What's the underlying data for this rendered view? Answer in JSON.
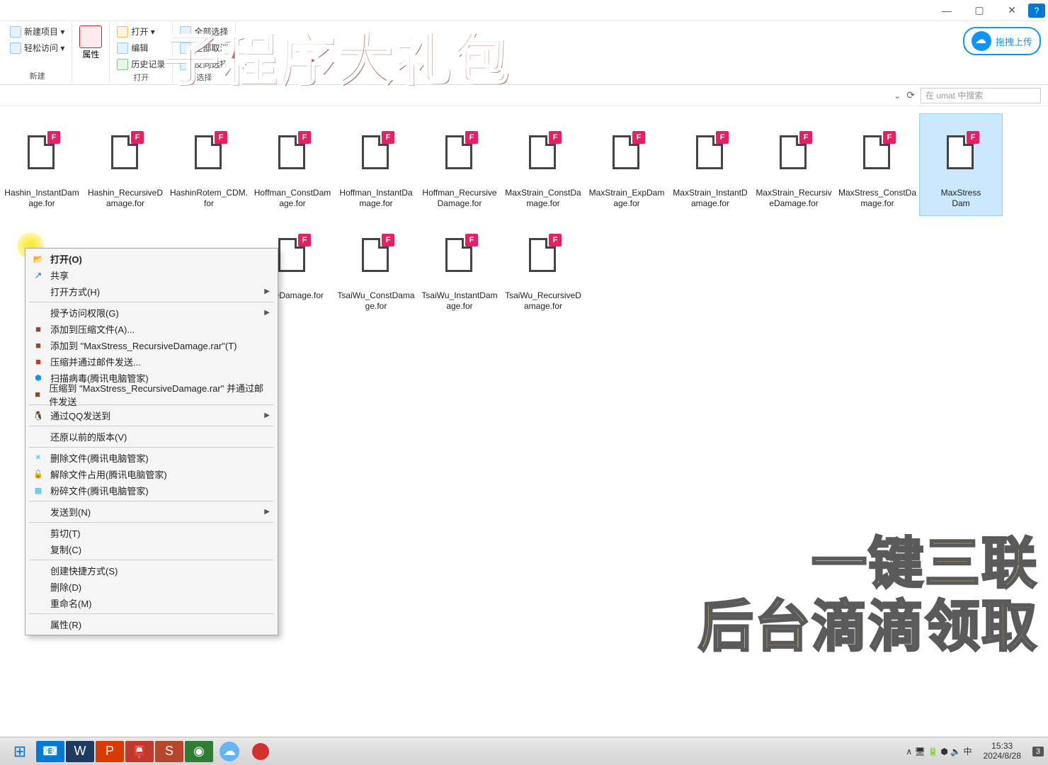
{
  "window": {
    "help": "?"
  },
  "ribbon": {
    "new_project": "新建项目 ▾",
    "quick_access": "轻松访问 ▾",
    "new_label": "新建",
    "properties": "属性",
    "open": "打开 ▾",
    "edit": "编辑",
    "history": "历史记录",
    "open_label": "打开",
    "select_all": "全部选择",
    "select_none": "全部取消",
    "invert": "反向选择",
    "select_label": "选择",
    "upload": "拖拽上传"
  },
  "addressbar": {
    "chevron": "⌄",
    "refresh": "⟳"
  },
  "search": {
    "placeholder": "在 umat 中搜索"
  },
  "files": [
    {
      "name": "Hashin_InstantDamage.for"
    },
    {
      "name": "Hashin_RecursiveDamage.for"
    },
    {
      "name": "HashinRotem_CDM.for"
    },
    {
      "name": "Hoffman_ConstDamage.for"
    },
    {
      "name": "Hoffman_InstantDamage.for"
    },
    {
      "name": "Hoffman_RecursiveDamage.for"
    },
    {
      "name": "MaxStrain_ConstDamage.for"
    },
    {
      "name": "MaxStrain_ExpDamage.for"
    },
    {
      "name": "MaxStrain_InstantDamage.for"
    },
    {
      "name": "MaxStrain_RecursiveDamage.for"
    },
    {
      "name": "MaxStress_ConstDamage.for"
    },
    {
      "name": "MaxStress_RecursiveDamage.for",
      "selected": true,
      "partial_left": "MaxStress\nDam"
    },
    {
      "name": "",
      "partial_hidden": true
    },
    {
      "name": "",
      "partial_hidden": true
    },
    {
      "name": "",
      "partial_hidden": true
    },
    {
      "name": "rsiveDamage.for",
      "partial_right": true
    },
    {
      "name": "TsaiWu_ConstDamage.for"
    },
    {
      "name": "TsaiWu_InstantDamage.for"
    },
    {
      "name": "TsaiWu_RecursiveDamage.for"
    }
  ],
  "context_menu": [
    {
      "icon": "open",
      "label": "打开(O)",
      "bold": true
    },
    {
      "icon": "share",
      "label": "共享"
    },
    {
      "label": "打开方式(H)",
      "arrow": true
    },
    {
      "sep": true
    },
    {
      "label": "授予访问权限(G)",
      "arrow": true
    },
    {
      "icon": "rar",
      "label": "添加到压缩文件(A)..."
    },
    {
      "icon": "rar",
      "label": "添加到 \"MaxStress_RecursiveDamage.rar\"(T)"
    },
    {
      "icon": "rar2",
      "label": "压缩并通过邮件发送..."
    },
    {
      "icon": "shield",
      "label": "扫描病毒(腾讯电脑管家)"
    },
    {
      "icon": "rar",
      "label": "压缩到 \"MaxStress_RecursiveDamage.rar\" 并通过邮件发送"
    },
    {
      "sep": true
    },
    {
      "icon": "qq",
      "label": "通过QQ发送到",
      "arrow": true
    },
    {
      "sep": true
    },
    {
      "label": "还原以前的版本(V)"
    },
    {
      "sep": true
    },
    {
      "icon": "del",
      "label": "删除文件(腾讯电脑管家)"
    },
    {
      "icon": "unlock",
      "label": "解除文件占用(腾讯电脑管家)"
    },
    {
      "icon": "shred",
      "label": "粉碎文件(腾讯电脑管家)"
    },
    {
      "sep": true
    },
    {
      "label": "发送到(N)",
      "arrow": true
    },
    {
      "sep": true
    },
    {
      "label": "剪切(T)"
    },
    {
      "label": "复制(C)"
    },
    {
      "sep": true
    },
    {
      "label": "创建快捷方式(S)"
    },
    {
      "label": "删除(D)"
    },
    {
      "label": "重命名(M)"
    },
    {
      "sep": true
    },
    {
      "label": "属性(R)"
    }
  ],
  "overlay": {
    "title": "子程序大礼包",
    "bottom1": "一键三联",
    "bottom2": "后台滴滴领取"
  },
  "taskbar": {
    "tray_icons": "∧ 🖥 🔋 ⬢ 🔈 中",
    "time": "15:33",
    "date": "2024/8/28",
    "notif": "3"
  }
}
